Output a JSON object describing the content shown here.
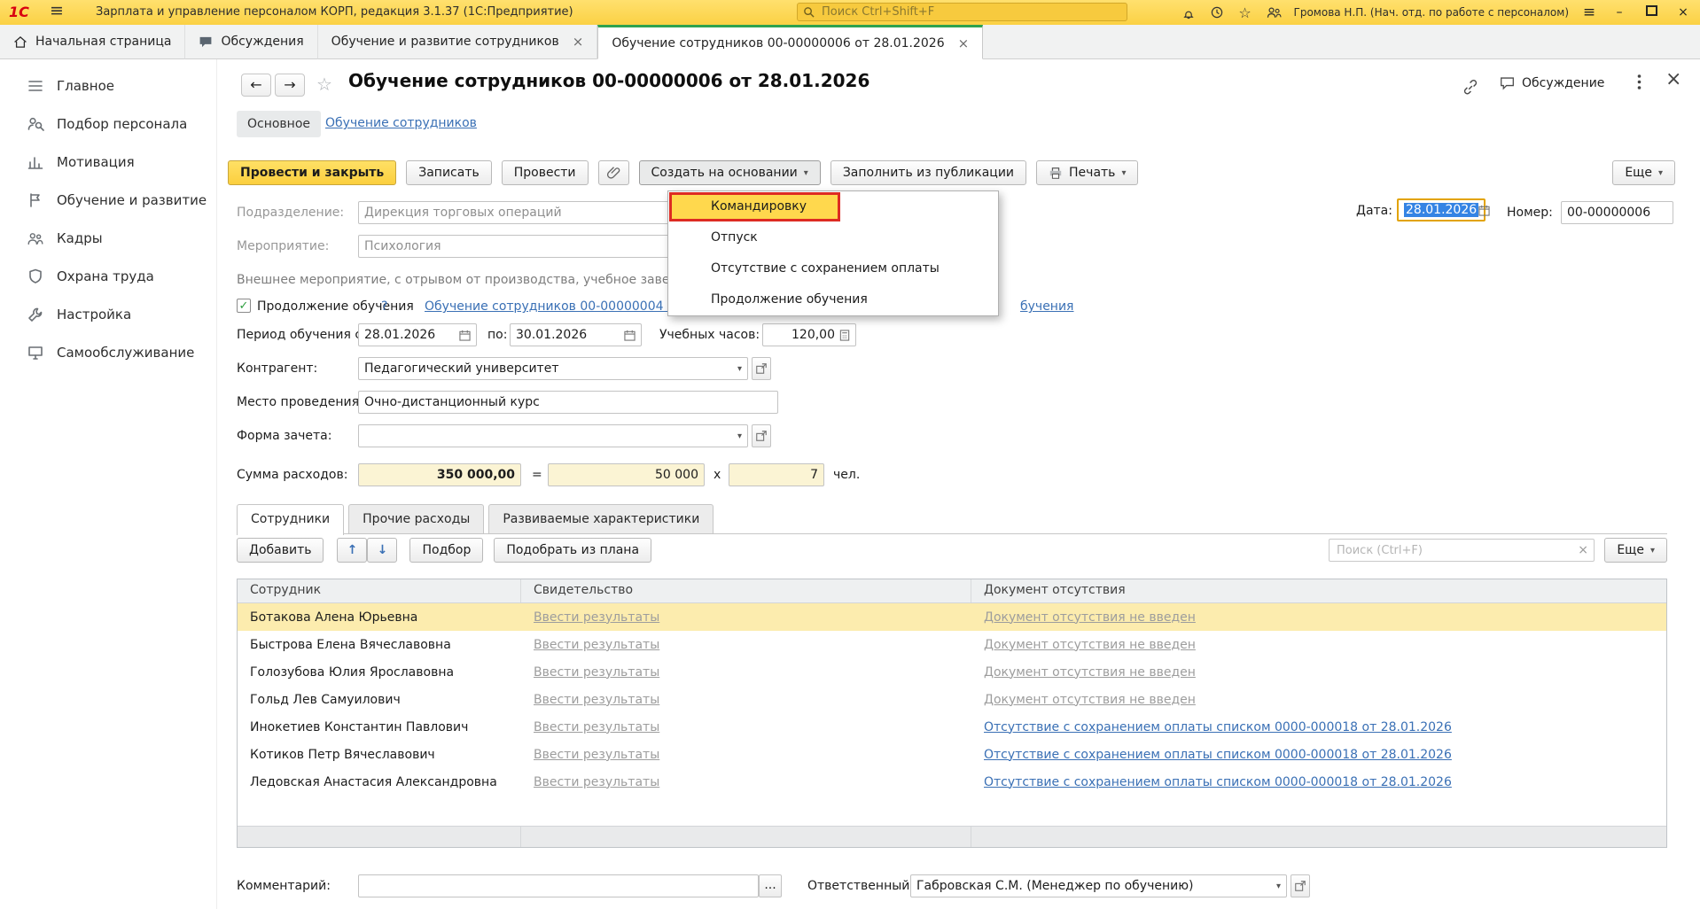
{
  "topbar": {
    "logo": "1С",
    "title": "Зарплата и управление персоналом КОРП, редакция 3.1.37 (1С:Предприятие)",
    "search_placeholder": "Поиск Ctrl+Shift+F",
    "user": "Громова Н.П. (Нач. отд. по работе с персоналом)"
  },
  "window_tabs": {
    "home": "Начальная страница",
    "discussions": "Обсуждения",
    "training_list": "Обучение и развитие сотрудников",
    "training_doc": "Обучение сотрудников 00-00000006 от 28.01.2026"
  },
  "sidebar": {
    "items": [
      "Главное",
      "Подбор персонала",
      "Мотивация",
      "Обучение и развитие",
      "Кадры",
      "Охрана труда",
      "Настройка",
      "Самообслуживание"
    ]
  },
  "doc": {
    "title": "Обучение сотрудников 00-00000006 от 28.01.2026",
    "discussion_label": "Обсуждение",
    "nav_main": "Основное",
    "nav_link": "Обучение сотрудников",
    "toolbar": {
      "post_and_close": "Провести и закрыть",
      "save": "Записать",
      "post": "Провести",
      "create_based_on": "Создать на основании",
      "fill_from_publication": "Заполнить из публикации",
      "print": "Печать",
      "more": "Еще"
    },
    "create_menu": {
      "items": [
        "Командировку",
        "Отпуск",
        "Отсутствие с сохранением оплаты",
        "Продолжение обучения"
      ],
      "highlighted": "Командировку"
    },
    "fields": {
      "department_label": "Подразделение:",
      "department": "Дирекция торговых операций",
      "date_label": "Дата:",
      "date": "28.01.2026",
      "number_label": "Номер:",
      "number": "00-00000006",
      "event_label": "Мероприятие:",
      "event": "Психология",
      "event_info": "Внешнее мероприятие, с отрывом от производства, учебное заведе",
      "continuation_checkbox": "Продолжение обучения",
      "help": "?",
      "continuation_link": "Обучение сотрудников 00-00000004 о",
      "continuation_link_tail": "бучения",
      "period_label": "Период обучения с:",
      "period_from": "28.01.2026",
      "to_label": "по:",
      "period_to": "30.01.2026",
      "hours_label": "Учебных часов:",
      "hours": "120,00",
      "contractor_label": "Контрагент:",
      "contractor": "Педагогический университет",
      "venue_label": "Место проведения:",
      "venue": "Очно-дистанционный курс",
      "credit_form_label": "Форма зачета:",
      "credit_form": "",
      "sum_label": "Сумма расходов:",
      "sum_total": "350 000,00",
      "equals": "=",
      "price": "50 000",
      "times": "x",
      "people_count": "7",
      "people_unit": "чел."
    },
    "employees_tabs": [
      "Сотрудники",
      "Прочие расходы",
      "Развиваемые характеристики"
    ],
    "employees_toolbar": {
      "add": "Добавить",
      "pick": "Подбор",
      "pick_from_plan": "Подобрать из плана",
      "search_placeholder": "Поиск (Ctrl+F)",
      "more": "Еще"
    },
    "table": {
      "columns": [
        "Сотрудник",
        "Свидетельство",
        "Документ отсутствия"
      ],
      "rows": [
        {
          "employee": "Ботакова Алена Юрьевна",
          "certificate": "Ввести результаты",
          "absence": "Документ отсутствия не введен",
          "absence_type": "gray",
          "selected": true
        },
        {
          "employee": "Быстрова Елена Вячеславовна",
          "certificate": "Ввести результаты",
          "absence": "Документ отсутствия не введен",
          "absence_type": "gray",
          "selected": false
        },
        {
          "employee": "Голозубова Юлия Ярославовна",
          "certificate": "Ввести результаты",
          "absence": "Документ отсутствия не введен",
          "absence_type": "gray",
          "selected": false
        },
        {
          "employee": "Гольд Лев Самуилович",
          "certificate": "Ввести результаты",
          "absence": "Документ отсутствия не введен",
          "absence_type": "gray",
          "selected": false
        },
        {
          "employee": "Инокетиев Константин Павлович",
          "certificate": "Ввести результаты",
          "absence": "Отсутствие с сохранением оплаты списком 0000-000018 от 28.01.2026",
          "absence_type": "blue",
          "selected": false
        },
        {
          "employee": "Котиков Петр Вячеславович",
          "certificate": "Ввести результаты",
          "absence": "Отсутствие с сохранением оплаты списком 0000-000018 от 28.01.2026",
          "absence_type": "blue",
          "selected": false
        },
        {
          "employee": "Ледовская Анастасия Александровна",
          "certificate": "Ввести результаты",
          "absence": "Отсутствие с сохранением оплаты списком 0000-000018 от 28.01.2026",
          "absence_type": "blue",
          "selected": false
        }
      ]
    },
    "footer": {
      "comment_label": "Комментарий:",
      "comment_value": "",
      "dots": "...",
      "responsible_label": "Ответственный:",
      "responsible": "Габровская С.М. (Менеджер по обучению)"
    }
  },
  "colors": {
    "accent_yellow": "#fcd640",
    "menu_highlight": "#ffd84d",
    "annotation_red": "#dd2b23",
    "link_blue": "#3a70b5",
    "selection_blue": "#3584e4",
    "active_tab_green": "#2fa24f",
    "selected_row": "#fcecae"
  }
}
